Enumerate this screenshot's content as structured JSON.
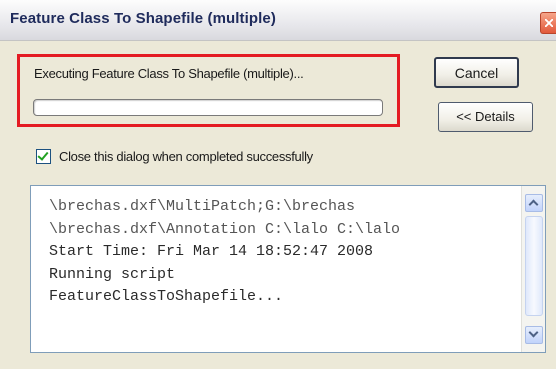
{
  "window": {
    "title": "Feature Class To Shapefile (multiple)"
  },
  "status": {
    "text": "Executing Feature Class To Shapefile (multiple)...",
    "progress": 0
  },
  "buttons": {
    "cancel_label": "Cancel",
    "details_label": "<< Details"
  },
  "options": {
    "close_when_done_label": "Close this dialog when completed successfully",
    "close_when_done_checked": true
  },
  "log": {
    "lines": [
      "\\brechas.dxf\\MultiPatch;G:\\brechas",
      "\\brechas.dxf\\Annotation C:\\lalo C:\\lalo",
      "Start Time: Fri Mar 14 18:52:47 2008",
      "Running script",
      "FeatureClassToShapefile..."
    ]
  },
  "colors": {
    "highlight_border": "#e41b23",
    "dialog_bg": "#ece9d8"
  },
  "icons": {
    "close": "close-icon",
    "scroll_up": "chevron-up-icon",
    "scroll_down": "chevron-down-icon",
    "check": "checkmark-icon"
  }
}
